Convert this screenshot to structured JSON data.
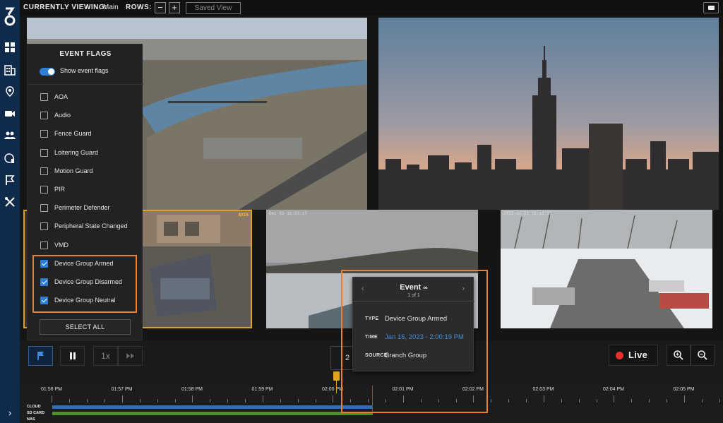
{
  "topbar": {
    "currently_viewing_label": "CURRENTLY VIEWING:",
    "currently_viewing_value": "Main",
    "rows_label": "ROWS:",
    "rows_minus": "−",
    "rows_plus": "+",
    "saved_view": "Saved View"
  },
  "nav": {
    "icons": [
      "grid-icon",
      "building-icon",
      "location-icon",
      "camera-icon",
      "users-icon",
      "shield-icon",
      "flag-icon",
      "tools-icon"
    ],
    "expand": "›"
  },
  "cameras": {
    "car_overlay": "AXIS",
    "lake_overlay": "Dec 21 16:13:27",
    "lot_overlay": "2022-12-21 16:13:31"
  },
  "event_flags": {
    "title": "EVENT FLAGS",
    "show_label": "Show event flags",
    "show_enabled": true,
    "items": [
      {
        "label": "AOA",
        "checked": false
      },
      {
        "label": "Audio",
        "checked": false
      },
      {
        "label": "Fence Guard",
        "checked": false
      },
      {
        "label": "Loitering Guard",
        "checked": false
      },
      {
        "label": "Motion Guard",
        "checked": false
      },
      {
        "label": "PIR",
        "checked": false
      },
      {
        "label": "Perimeter Defender",
        "checked": false
      },
      {
        "label": "Peripheral State Changed",
        "checked": false
      },
      {
        "label": "VMD",
        "checked": false
      },
      {
        "label": "Device Group Armed",
        "checked": true
      },
      {
        "label": "Device Group Disarmed",
        "checked": true
      },
      {
        "label": "Device Group Neutral",
        "checked": true
      }
    ],
    "select_all": "SELECT ALL"
  },
  "controls": {
    "speed": "1x",
    "time_partial": "2",
    "live": "Live",
    "live_color": "#e53030"
  },
  "event_popup": {
    "title": "Event",
    "count": "1 of 1",
    "type_key": "TYPE",
    "type_value": "Device Group Armed",
    "time_key": "TIME",
    "time_value": "Jan 16, 2023 - 2:00:19 PM",
    "source_key": "SOURCE",
    "source_value": "Branch Group",
    "prev": "‹",
    "next": "›"
  },
  "timeline": {
    "ticks": [
      "01:56 PM",
      "01:57 PM",
      "01:58 PM",
      "01:59 PM",
      "02:00 PM",
      "02:01 PM",
      "02:02 PM",
      "02:03 PM",
      "02:04 PM",
      "02:05 PM"
    ],
    "tracks": [
      "CLOUD",
      "SD CARD",
      "NAS"
    ],
    "cloud_color": "#2d6fbf",
    "sd_color": "#4f8f2b",
    "accent_color": "#ef7f2b",
    "event_color": "#e0a21c"
  }
}
